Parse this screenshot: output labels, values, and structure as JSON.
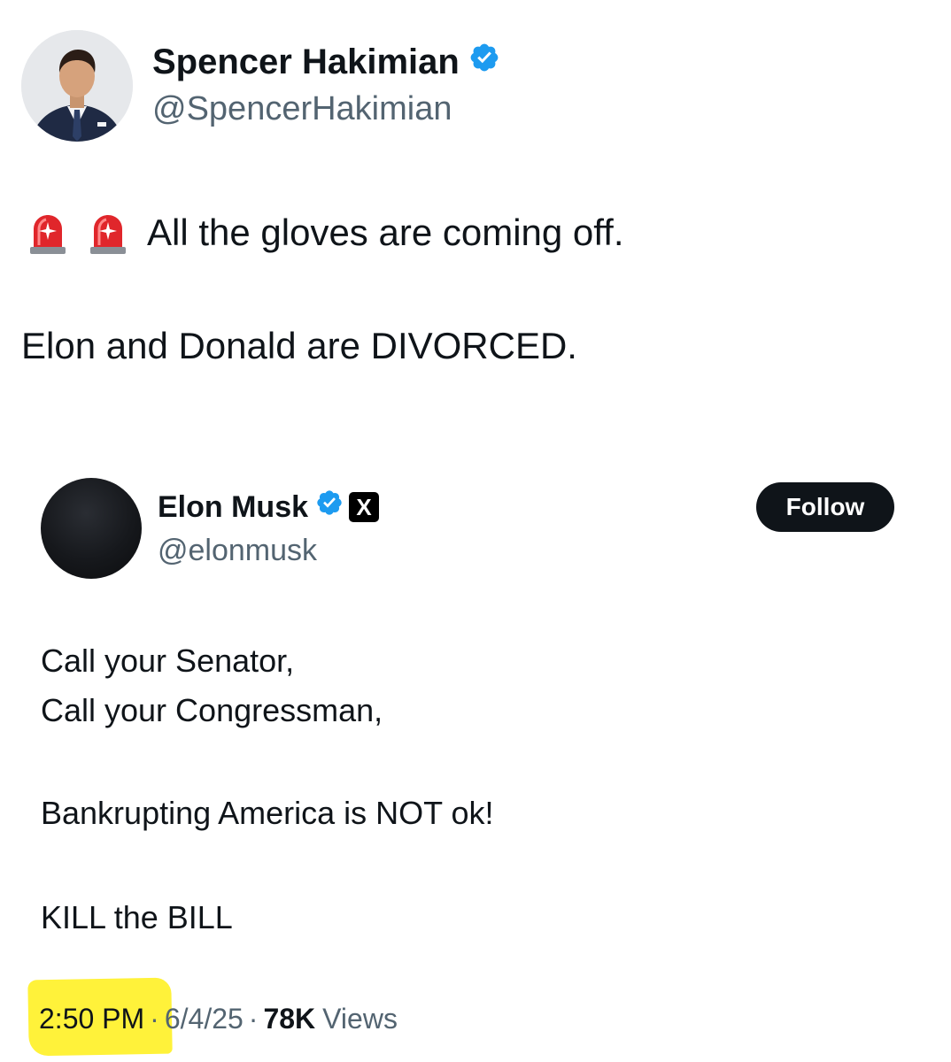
{
  "outer_tweet": {
    "author_name": "Spencer Hakimian",
    "author_handle": "@SpencerHakimian",
    "verified": true,
    "line1_icons": [
      "police-siren-icon",
      "police-siren-icon"
    ],
    "line1_text": "All the gloves are coming off.",
    "line2_text": "Elon and Donald are DIVORCED."
  },
  "quoted_tweet": {
    "author_name": "Elon Musk",
    "author_handle": "@elonmusk",
    "verified": true,
    "affiliate_badge": "X",
    "follow_label": "Follow",
    "lines": [
      "Call your Senator,",
      "Call your Congressman,",
      "Bankrupting America is NOT ok!",
      "KILL the BILL"
    ],
    "time": "2:50 PM",
    "separator": "·",
    "date": "6/4/25",
    "views_count": "78K",
    "views_label": "Views"
  },
  "colors": {
    "verified_blue": "#1d9bf0",
    "secondary_text": "#536471",
    "highlight_yellow": "#fff23a",
    "follow_button_bg": "#0f1419"
  }
}
